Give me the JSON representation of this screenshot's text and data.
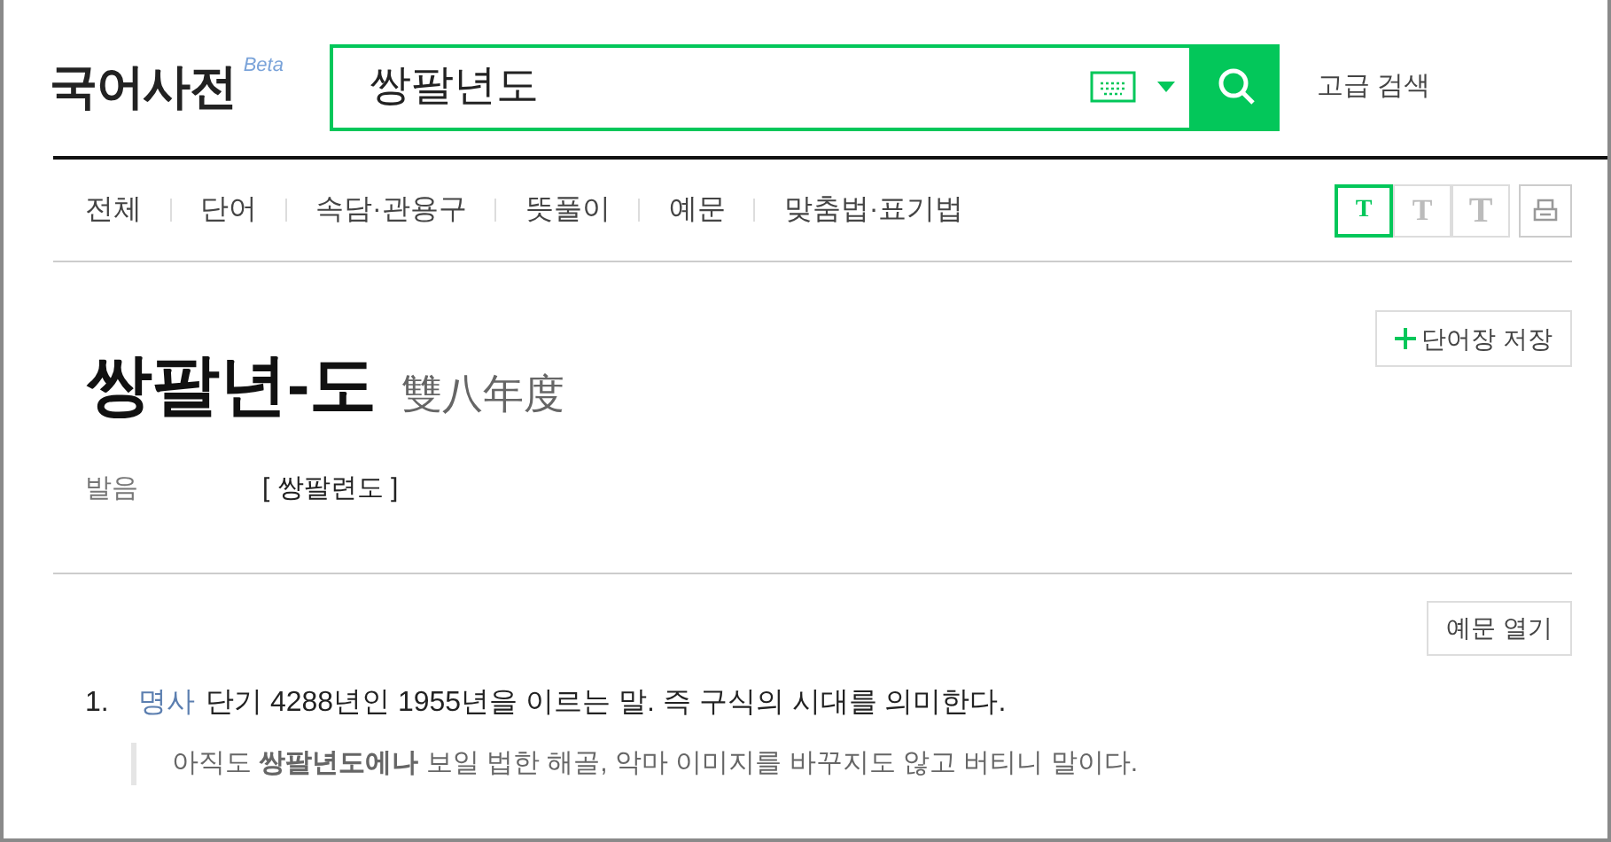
{
  "logo": {
    "title": "국어사전",
    "badge": "Beta"
  },
  "search": {
    "value": "쌍팔년도"
  },
  "advanced_search": "고급 검색",
  "tabs": [
    {
      "label": "전체",
      "selected": false
    },
    {
      "label": "단어",
      "selected": false
    },
    {
      "label": "속담·관용구",
      "selected": false
    },
    {
      "label": "뜻풀이",
      "selected": false
    },
    {
      "label": "예문",
      "selected": false
    },
    {
      "label": "맞춤법·표기법",
      "selected": false
    }
  ],
  "font_sizes": [
    {
      "label": "T",
      "selected": true
    },
    {
      "label": "T",
      "selected": false
    },
    {
      "label": "T",
      "selected": false
    }
  ],
  "entry": {
    "headword": "쌍팔년-도",
    "hanja": "雙八年度",
    "save_button": "단어장 저장",
    "pronunciation_label": "발음",
    "pronunciation": "[ 쌍팔련도 ]",
    "examples_button": "예문 열기",
    "senses": [
      {
        "number": "1.",
        "pos": "명사",
        "definition": "단기 4288년인 1955년을 이르는 말. 즉 구식의 시대를 의미한다.",
        "example": "아직도 **쌍팔년도에나** 보일 법한 해골, 악마 이미지를 바꾸지도 않고 버티니 말이다."
      }
    ]
  }
}
